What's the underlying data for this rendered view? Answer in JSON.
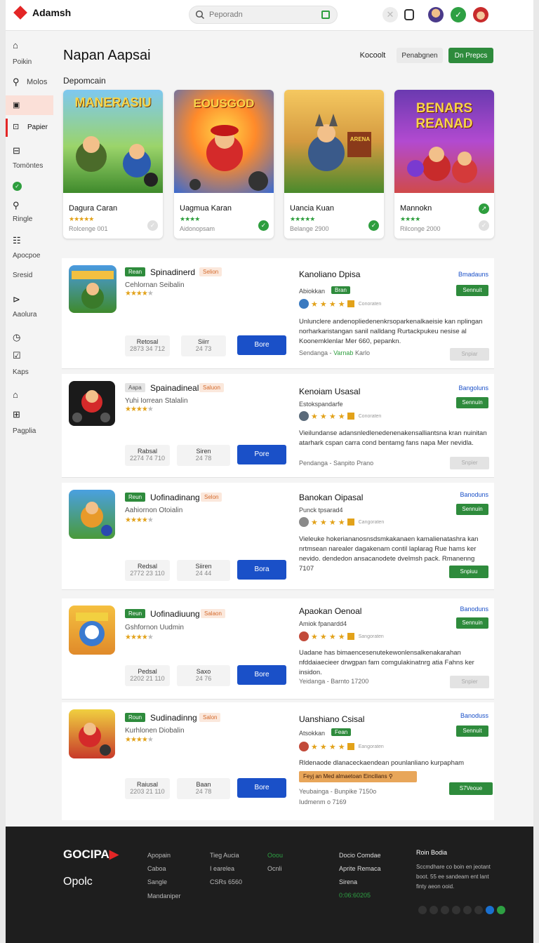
{
  "header": {
    "brand": "Adamsh",
    "search_placeholder": "Peporadn"
  },
  "sidebar": {
    "items": [
      {
        "label": "Poikin",
        "icon": "home-icon"
      },
      {
        "label": "Molos",
        "icon": "search-icon"
      },
      {
        "label": "",
        "icon": "bag-icon"
      },
      {
        "label": "Papier",
        "icon": "terminal-icon"
      },
      {
        "label": "Tomöntes",
        "icon": "square-icon"
      },
      {
        "label": "",
        "icon": "check-icon"
      },
      {
        "label": "Ringle",
        "icon": "search-icon"
      },
      {
        "label": "Apocpoe",
        "icon": "grid-icon"
      },
      {
        "label": "Sresid",
        "icon": ""
      },
      {
        "label": "Aaolura",
        "icon": "terminal-icon"
      },
      {
        "label": "",
        "icon": "clock-icon"
      },
      {
        "label": "Kaps",
        "icon": "checkbox-icon"
      },
      {
        "label": "",
        "icon": "home-icon"
      },
      {
        "label": "Pagplia",
        "icon": "bag-icon"
      }
    ]
  },
  "main": {
    "title": "Napan Aapsai",
    "buttons": {
      "b1": "Kocoolt",
      "b2": "Penabgnen",
      "b3": "Dn Prepcs"
    },
    "section_label": "Depomcain",
    "featured": [
      {
        "art_text": "MANERASIU",
        "name": "Dagura Caran",
        "sub": "Rolcenge 001",
        "badge": "inactive"
      },
      {
        "art_text": "EOUSGOD",
        "name": "Uagmua Karan",
        "sub": "Aidonopsam",
        "badge": "check"
      },
      {
        "art_text": "ARENA",
        "name": "Uancia Kuan",
        "sub": "Belange 2900",
        "badge": "check"
      },
      {
        "art_text": "BENARS REANAD",
        "name": "Mannokn",
        "sub": "Rilconge 2000",
        "badge": "trend"
      }
    ],
    "rows": [
      {
        "tag": "Rean",
        "name": "Spinadinerd",
        "tag2": "Selion",
        "sub": "Cehlornan Seibalin",
        "stat1_t": "Retosal",
        "stat1_v": "2873 34 712",
        "stat2_t": "Siirr",
        "stat2_v": "24 73",
        "btn": "Bore",
        "rtitle": "Kanoliano Dpisa",
        "rsub": "Abiokkan",
        "rsub_tag": "Bran",
        "mini": "Conoraten",
        "desc": "Unlunclere andenopliedenenkrsoparkenalkaeisie kan nplingan norharkaristangan sanil nalldang Rurtackpukeu nesise al Koonemklenlar Mer 660, pepankn.",
        "meta": "Sendanga -",
        "meta_g": "Varnab",
        "meta2": "Karlo",
        "rlink": "Bmadauns",
        "gbtn": "Sennuit",
        "bottom_btn": "Snpiar",
        "bottom_style": "gray"
      },
      {
        "tag": "Aapa",
        "name": "Spainadineal",
        "tag2": "Saluon",
        "sub": "Yuhi Iorrean Stalalin",
        "stat1_t": "Rabsal",
        "stat1_v": "2274 74 710",
        "stat2_t": "Siren",
        "stat2_v": "24 78",
        "btn": "Pore",
        "rtitle": "Kenoiam Usasal",
        "rsub": "Estokspandarfe",
        "rsub_tag": "",
        "mini": "Conoraten",
        "desc": "Vieilundanse adansnledlenedenenakensalliantsna kran nuinitan atarhark cspan carra cond bentamg fans napa Mer nevidla.",
        "meta": "Pendanga - Sanpito Prano",
        "meta_g": "",
        "meta2": "",
        "rlink": "Bangoluns",
        "gbtn": "Sennuin",
        "bottom_btn": "Snpier",
        "bottom_style": "gray"
      },
      {
        "tag": "Reun",
        "name": "Uofinadinang",
        "tag2": "Selon",
        "sub": "Aahiornon Otoialin",
        "stat1_t": "Redsal",
        "stat1_v": "2772 23 110",
        "stat2_t": "Siiren",
        "stat2_v": "24 44",
        "btn": "Bora",
        "rtitle": "Banokan Oipasal",
        "rsub": "Punck tpsarad4",
        "rsub_tag": "",
        "mini": "Cangoraten",
        "desc": "Vieleuke hokeriananosnsdsmkakanaen kamalienatashra kan nrtmsean narealer dagakenam contil laplarag Rue hams ker nevido. dendedon ansacanodete dvelmsh pack. Rmanenng 7107",
        "meta": "",
        "meta_g": "",
        "meta2": "",
        "rlink": "Banoduns",
        "gbtn": "Sennuin",
        "bottom_btn": "Snpiuu",
        "bottom_style": "green"
      },
      {
        "tag": "Reun",
        "name": "Uofinadiuung",
        "tag2": "Salaon",
        "sub": "Gshfornon Uudmin",
        "stat1_t": "Pedsal",
        "stat1_v": "2202 21 110",
        "stat2_t": "Saxo",
        "stat2_v": "24 76",
        "btn": "Bore",
        "rtitle": "Apaokan Oenoal",
        "rsub": "Amiok fpanardd4",
        "rsub_tag": "",
        "mini": "Sangoraten",
        "desc": "Uadane has bimaencesenutekewonlensalkenakarahan nfddaiaecieer drwgpan fam comgulakinatnrg atia Fahns ker insidon.",
        "meta": "Yeidanga - Barnto 17200",
        "meta_g": "",
        "meta2": "",
        "rlink": "Banoduns",
        "gbtn": "Sennuin",
        "bottom_btn": "Snpier",
        "bottom_style": "gray"
      },
      {
        "tag": "Roun",
        "name": "Sudinadinng",
        "tag2": "Salon",
        "sub": "Kurhlonen Diobalin",
        "stat1_t": "Raiusal",
        "stat1_v": "2203 21 110",
        "stat2_t": "Baan",
        "stat2_v": "24 78",
        "btn": "Bore",
        "rtitle": "Uanshiano Csisal",
        "rsub": "Atsokkan",
        "rsub_tag": "Fean",
        "mini": "Eangoraten",
        "desc": "Rldenaode dlanaceckaendean pounlanliano kurpapham",
        "promo": "Feyj an Med almaetoan Eincilians",
        "meta": "Yeubainga - Bunpike 7150o",
        "meta_g": "",
        "meta2": "Iudmenm o 7169",
        "rlink": "Banoduss",
        "gbtn": "Sennuit",
        "bottom_btn": "S7Veoue",
        "bottom_style": "green"
      }
    ]
  },
  "footer": {
    "brand": "GOCIPA",
    "tagline": "Opolc",
    "c1": [
      "Apopain",
      "Caboa",
      "Sangle"
    ],
    "c1b": "Mandaniper",
    "c2": [
      "Tieg Aucia",
      "I earelea",
      "CSRs 6560"
    ],
    "c3": [
      "Ooou",
      "Ocnli"
    ],
    "c4": [
      "Docio Comdae",
      "Aprite Remaca",
      "Sirena",
      "0:06:60205"
    ],
    "c5_title": "Roin Bodia",
    "c5": "Sccmdhare co boin en jeotant boot. 55 ee sandeam ent lant finty aeon ooid."
  },
  "colors": {
    "brand": "#e32626",
    "green": "#2e8b3c",
    "blue": "#1a50c8",
    "star": "#e2a21a"
  }
}
